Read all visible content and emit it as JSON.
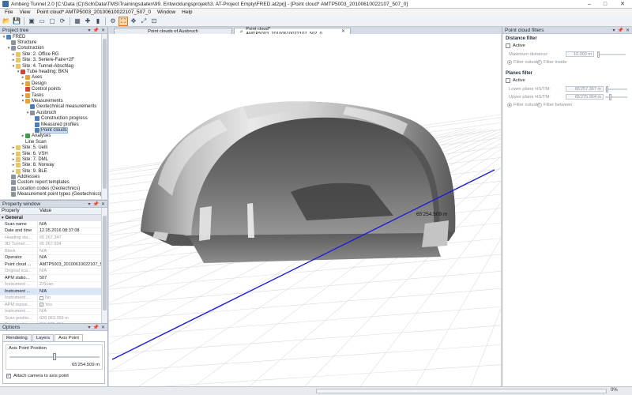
{
  "window": {
    "title": "Amberg Tunnel 2.0 [C:\\Data (C)\\Sch\\Data\\TMS\\Trainingsdaten\\99. Entwicklungsprojekt\\3. AT-Project Empty\\FRED.at2prj] - [Point cloud* AMTP5003_20100610022107_507_0]",
    "controls": [
      "–",
      "□",
      "✕"
    ]
  },
  "menu": [
    "File",
    "View",
    "Point cloud* AMTP5003_20100610022107_507_0",
    "Window",
    "Help"
  ],
  "toolbar": {
    "icons": [
      "open-folder-icon",
      "save-icon",
      "save-all-icon",
      "layout-icon",
      "window-icon",
      "refresh-icon",
      "grid-icon",
      "add-icon",
      "delete-icon",
      "settings-icon",
      "measure-icon",
      "zoom-icon",
      "pan-icon",
      "fit-icon"
    ],
    "glyphs": [
      "📂",
      "💾",
      "▣",
      "▭",
      "▢",
      "⟳",
      "▦",
      "✚",
      "▮",
      "⚙",
      "⛶",
      "✥",
      "⤢",
      "⊡"
    ],
    "active_index": 10
  },
  "project_tree": {
    "header": "Project tree",
    "header_controls": [
      "▾",
      "📌",
      "✕"
    ],
    "items": [
      {
        "label": "FRED",
        "depth": 0,
        "exp": "▾",
        "icon": "blue"
      },
      {
        "label": "Structure",
        "depth": 1,
        "exp": "",
        "icon": "gray"
      },
      {
        "label": "Construction",
        "depth": 1,
        "exp": "▾",
        "icon": "gray"
      },
      {
        "label": "Site: 2. Office RG",
        "depth": 2,
        "exp": "▸",
        "icon": "folder"
      },
      {
        "label": "Site: 3. Seriere-Faire+2F",
        "depth": 2,
        "exp": "▸",
        "icon": "folder"
      },
      {
        "label": "Site: 4. Tunnel-Abschlag",
        "depth": 2,
        "exp": "▾",
        "icon": "folder"
      },
      {
        "label": "Tube heading: BKN",
        "depth": 3,
        "exp": "▾",
        "icon": "red"
      },
      {
        "label": "Axes",
        "depth": 4,
        "exp": "▸",
        "icon": "orange"
      },
      {
        "label": "Design",
        "depth": 4,
        "exp": "▸",
        "icon": "orange"
      },
      {
        "label": "Control points",
        "depth": 4,
        "exp": "",
        "icon": "red"
      },
      {
        "label": "Tasks",
        "depth": 4,
        "exp": "▸",
        "icon": "orange"
      },
      {
        "label": "Measurements",
        "depth": 4,
        "exp": "▾",
        "icon": "orange"
      },
      {
        "label": "Geotechnical measurements",
        "depth": 5,
        "exp": "",
        "icon": "blue"
      },
      {
        "label": "Ausbruch",
        "depth": 5,
        "exp": "▾",
        "icon": "gray"
      },
      {
        "label": "Construction progress",
        "depth": 6,
        "exp": "",
        "icon": "blue"
      },
      {
        "label": "Measured profiles",
        "depth": 6,
        "exp": "",
        "icon": "blue"
      },
      {
        "label": "Point clouds",
        "depth": 6,
        "exp": "",
        "icon": "blue",
        "selected": true
      },
      {
        "label": "Analyses",
        "depth": 4,
        "exp": "▸",
        "icon": "green"
      },
      {
        "label": "Line Scan",
        "depth": 4,
        "exp": "",
        "icon": ""
      },
      {
        "label": "Site: 5. Uelli",
        "depth": 2,
        "exp": "▸",
        "icon": "folder"
      },
      {
        "label": "Site: 6. VSH",
        "depth": 2,
        "exp": "▸",
        "icon": "folder"
      },
      {
        "label": "Site: 7. DML",
        "depth": 2,
        "exp": "▸",
        "icon": "folder"
      },
      {
        "label": "Site: 8. Norway",
        "depth": 2,
        "exp": "▸",
        "icon": "folder"
      },
      {
        "label": "Site: 9. BLE",
        "depth": 2,
        "exp": "▸",
        "icon": "folder"
      },
      {
        "label": "Addresses",
        "depth": 1,
        "exp": "",
        "icon": "gray"
      },
      {
        "label": "Custom report templates",
        "depth": 1,
        "exp": "",
        "icon": "gray"
      },
      {
        "label": "Location codes (Geotechnics)",
        "depth": 1,
        "exp": "",
        "icon": "gray"
      },
      {
        "label": "Measurement point types (Geotechnics)",
        "depth": 1,
        "exp": "",
        "icon": "gray"
      }
    ]
  },
  "property_window": {
    "header": "Property window",
    "col_property": "Property",
    "col_value": "Value",
    "group": "General",
    "rows": [
      {
        "name": "Scan name",
        "value": "N/A",
        "state": "normal"
      },
      {
        "name": "Date and time",
        "value": "12.05.2016 08:37:08",
        "state": "normal"
      },
      {
        "name": "Heading sta...",
        "value": "65 267.347",
        "state": "disabled"
      },
      {
        "name": "3D Tunnel:...",
        "value": "65 267.534",
        "state": "disabled"
      },
      {
        "name": "Block",
        "value": "N/A",
        "state": "disabled"
      },
      {
        "name": "Operator",
        "value": "N/A",
        "state": "normal"
      },
      {
        "name": "Point cloud ...",
        "value": "AMTP5003_20100610022107_50...",
        "state": "normal"
      },
      {
        "name": "Original sca...",
        "value": "N/A",
        "state": "disabled"
      },
      {
        "name": "APM statio...",
        "value": "507",
        "state": "normal"
      },
      {
        "name": "Instrument ...",
        "value": "Z/Scan",
        "state": "disabled"
      },
      {
        "name": "Instrument ...",
        "value": "N/A",
        "state": "selected"
      },
      {
        "name": "Instrument ...",
        "value": "No",
        "state": "disabled",
        "check": ""
      },
      {
        "name": "APM reposi...",
        "value": "Yes",
        "state": "disabled",
        "check": "✓"
      },
      {
        "name": "Instrument ...",
        "value": "N/A",
        "state": "disabled"
      },
      {
        "name": "Scan positio...",
        "value": "628 063.359 m",
        "state": "disabled"
      },
      {
        "name": "Scan positio...",
        "value": "811 509.404 m",
        "state": "disabled"
      },
      {
        "name": "Scan positio...",
        "value": "509.127 m",
        "state": "disabled"
      }
    ]
  },
  "options": {
    "header": "Options",
    "tabs": [
      "Rendering",
      "Layers",
      "Axis Point"
    ],
    "active_tab": 2,
    "axis_point_label": "Axis Point Position",
    "axis_point_value": "65'254.509 m",
    "axis_slider_fraction": 0.5,
    "attach_label": "Attach camera to axis point",
    "attach_checked": "✓"
  },
  "documents": {
    "tabs": [
      {
        "label": "Point clouds of Ausbruch"
      },
      {
        "label": "Point cloud* AMTP5003_20100610022107_507_0"
      }
    ],
    "close": "✕",
    "pin": "⊿"
  },
  "viewport": {
    "station_label": "65'254.509 m",
    "axis_color": "#1a1fd6",
    "grid_color": "#dcdcdc"
  },
  "filters": {
    "header": "Point cloud filters",
    "distance": {
      "title": "Distance filter",
      "active_label": "Active",
      "max_distance_label": "Maximum distance:",
      "max_distance_value": "10.000 m",
      "radio_outside": "Filter outside",
      "radio_inside": "Filter inside"
    },
    "planes": {
      "title": "Planes filter",
      "active_label": "Active",
      "lower_label": "Lower plane HS/TM:",
      "lower_value": "65'257.367 m",
      "upper_label": "Upper plane HS/TM:",
      "upper_value": "65'275.964 m",
      "radio_outside": "Filter outside",
      "radio_between": "Filter between"
    }
  },
  "status": {
    "progress_text": "0%",
    "progress_fraction": 0.0
  }
}
